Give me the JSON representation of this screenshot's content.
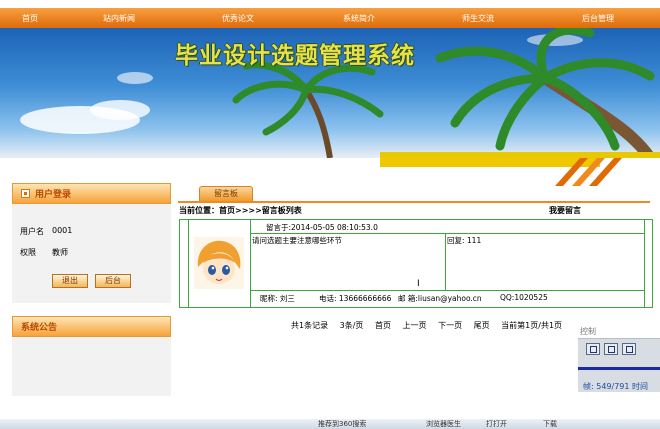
{
  "nav": {
    "items": [
      "首页",
      "站内新闻",
      "优秀论文",
      "系统简介",
      "师生交流",
      "后台管理"
    ]
  },
  "banner": {
    "title": "毕业设计选题管理系统"
  },
  "login_panel": {
    "header": "用户登录",
    "username_label": "用户名",
    "username_value": "0001",
    "role_label": "权限",
    "role_value": "教师",
    "logout_button": "退出",
    "admin_button": "后台"
  },
  "notice_panel": {
    "header": "系统公告"
  },
  "board": {
    "tab": "留言板",
    "breadcrumb": "当前位置：首页>>>>留言板列表",
    "post_link": "我要留言",
    "message": {
      "posted_at": "留言于:2014-05-05 08:10:53.0",
      "content": "请问选题主要注意哪些环节",
      "reply": "回复: 111",
      "nickname": "昵称: 刘三",
      "phone": "电话: 13666666666",
      "email": "邮 箱:liusan@yahoo.cn",
      "qq": "QQ:1020525"
    },
    "pager": [
      "共1条记录",
      "3条/页",
      "首页",
      "上一页",
      "下一页",
      "尾页",
      "当前第1页/共1页"
    ]
  },
  "player": {
    "control_label": "控制",
    "frames": "帧:  549/791  时间"
  },
  "taskbar": {
    "items": [
      "推荐到360搜索",
      "浏览器医生",
      "打打开",
      "下载"
    ]
  },
  "colors": {
    "accent": "#e06a08",
    "grid": "#3aa83a",
    "banner_title": "#e8e24a"
  }
}
